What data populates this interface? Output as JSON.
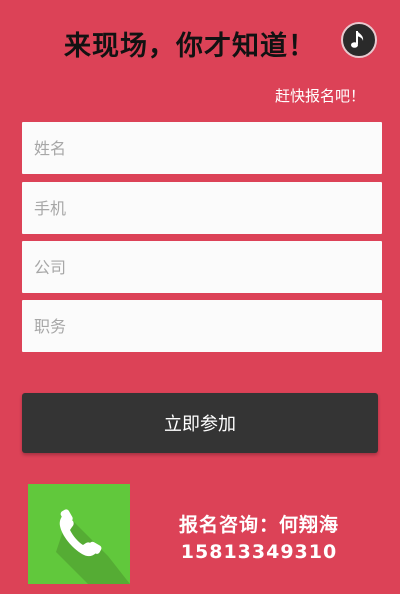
{
  "header": {
    "title": "来现场，你才知道！",
    "subtitle": "赶快报名吧！",
    "music_icon": "music-note-icon"
  },
  "form": {
    "name_placeholder": "姓名",
    "phone_placeholder": "手机",
    "company_placeholder": "公司",
    "position_placeholder": "职务",
    "submit_label": "立即参加"
  },
  "contact": {
    "phone_icon": "phone-icon",
    "label": "报名咨询：何翔海",
    "number": "15813349310"
  },
  "colors": {
    "background": "#dc4257",
    "button": "#343434",
    "phone_tile": "#61c83c"
  }
}
